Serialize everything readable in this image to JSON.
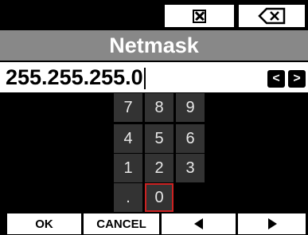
{
  "header": {
    "clear_icon": "clear-icon",
    "backspace_icon": "backspace-icon"
  },
  "title": "Netmask",
  "input": {
    "value": "255.255.255.0"
  },
  "cursor_controls": {
    "left": "<",
    "right": ">"
  },
  "keypad": {
    "keys": [
      "7",
      "8",
      "9",
      "4",
      "5",
      "6",
      "1",
      "2",
      "3",
      ".",
      "0"
    ],
    "selected": "0"
  },
  "footer": {
    "ok": "OK",
    "cancel": "CANCEL",
    "prev_icon": "prev-triangle-icon",
    "next_icon": "next-triangle-icon"
  },
  "colors": {
    "title_bar": "#888888",
    "key_bg": "#333333",
    "selected_border": "#cc2222"
  }
}
